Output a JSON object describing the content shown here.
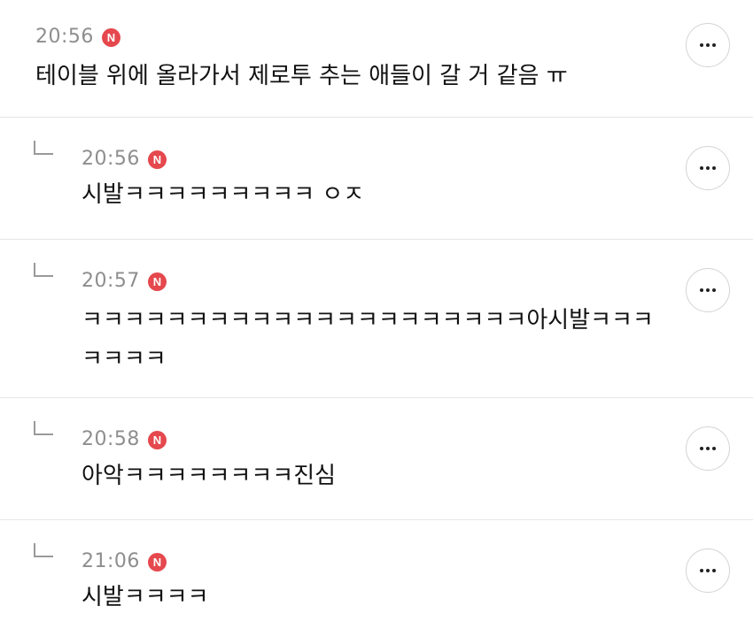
{
  "badge_label": "N",
  "more_icon": "more-horizontal-icon",
  "badge_color": "#e5484d",
  "comments": [
    {
      "time": "20:56",
      "text": "테이블 위에 올라가서 제로투 추는 애들이 갈 거 같음 ㅠ",
      "is_reply": false
    },
    {
      "time": "20:56",
      "text": "시발ㅋㅋㅋㅋㅋㅋㅋㅋㅋ ㅇㅈ",
      "is_reply": true
    },
    {
      "time": "20:57",
      "text": "ㅋㅋㅋㅋㅋㅋㅋㅋㅋㅋㅋㅋㅋㅋㅋㅋㅋㅋㅋㅋㅋ아시발ㅋㅋㅋㅋㅋㅋㅋ",
      "is_reply": true
    },
    {
      "time": "20:58",
      "text": "아악ㅋㅋㅋㅋㅋㅋㅋㅋ진심",
      "is_reply": true
    },
    {
      "time": "21:06",
      "text": "시발ㅋㅋㅋㅋ",
      "is_reply": true
    }
  ]
}
